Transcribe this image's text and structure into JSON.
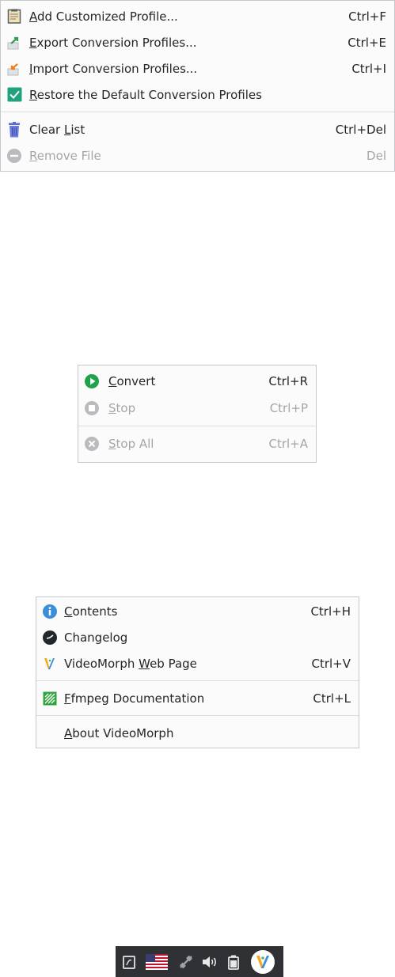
{
  "file_menu": {
    "items": [
      {
        "label": "Add Customized Profile...",
        "mnemonic_prefix": "",
        "mnemonic": "A",
        "rest": "dd Customized Profile...",
        "shortcut": "Ctrl+F",
        "icon": "clipboard-icon",
        "enabled": true
      },
      {
        "label": "Export Conversion Profiles...",
        "mnemonic_prefix": "",
        "mnemonic": "E",
        "rest": "xport Conversion Profiles...",
        "shortcut": "Ctrl+E",
        "icon": "export-icon",
        "enabled": true
      },
      {
        "label": "Import Conversion Profiles...",
        "mnemonic_prefix": "",
        "mnemonic": "I",
        "rest": "mport Conversion Profiles...",
        "shortcut": "Ctrl+I",
        "icon": "import-icon",
        "enabled": true
      },
      {
        "label": "Restore the Default Conversion Profiles",
        "mnemonic_prefix": "",
        "mnemonic": "R",
        "rest": "estore the Default Conversion Profiles",
        "shortcut": "",
        "icon": "restore-checkbox-icon",
        "enabled": true
      },
      {
        "label": "Clear List",
        "mnemonic_prefix": "Clear ",
        "mnemonic": "L",
        "rest": "ist",
        "shortcut": "Ctrl+Del",
        "icon": "trash-icon",
        "enabled": true
      },
      {
        "label": "Remove File",
        "mnemonic_prefix": "",
        "mnemonic": "R",
        "rest": "emove File",
        "shortcut": "Del",
        "icon": "remove-icon",
        "enabled": false
      }
    ]
  },
  "convert_menu": {
    "items": [
      {
        "label": "Convert",
        "mnemonic_prefix": "",
        "mnemonic": "C",
        "rest": "onvert",
        "shortcut": "Ctrl+R",
        "icon": "play-icon",
        "enabled": true
      },
      {
        "label": "Stop",
        "mnemonic_prefix": "",
        "mnemonic": "S",
        "rest": "top",
        "shortcut": "Ctrl+P",
        "icon": "stop-icon",
        "enabled": false
      },
      {
        "label": "Stop All",
        "mnemonic_prefix": "",
        "mnemonic": "S",
        "rest": "top All",
        "shortcut": "Ctrl+A",
        "icon": "stop-all-icon",
        "enabled": false
      }
    ]
  },
  "help_menu": {
    "items": [
      {
        "label": "Contents",
        "mnemonic_prefix": "",
        "mnemonic": "C",
        "rest": "ontents",
        "shortcut": "Ctrl+H",
        "icon": "info-icon",
        "enabled": true
      },
      {
        "label": "Changelog",
        "mnemonic_prefix": "Changelog",
        "mnemonic": "",
        "rest": "",
        "shortcut": "",
        "icon": "clock-icon",
        "enabled": true
      },
      {
        "label": "VideoMorph Web Page",
        "mnemonic_prefix": "VideoMorph ",
        "mnemonic": "W",
        "rest": "eb Page",
        "shortcut": "Ctrl+V",
        "icon": "videomorph-logo-icon",
        "enabled": true
      },
      {
        "label": "Ffmpeg Documentation",
        "mnemonic_prefix": "",
        "mnemonic": "F",
        "rest": "fmpeg Documentation",
        "shortcut": "Ctrl+L",
        "icon": "ffmpeg-icon",
        "enabled": true
      },
      {
        "label": "About VideoMorph",
        "mnemonic_prefix": "",
        "mnemonic": "A",
        "rest": "bout VideoMorph",
        "shortcut": "",
        "icon": "",
        "enabled": true
      }
    ]
  },
  "tray": {
    "icons": [
      "clipboard-tray-icon",
      "us-flag-icon",
      "network-disconnected-icon",
      "volume-icon",
      "battery-icon",
      "videomorph-tray-icon"
    ]
  },
  "colors": {
    "menu_bg": "#fbfbfb",
    "text": "#232629",
    "disabled_text": "#a3a5a7",
    "accent_green": "#1fa24a",
    "tray_bg": "#2f3134"
  }
}
